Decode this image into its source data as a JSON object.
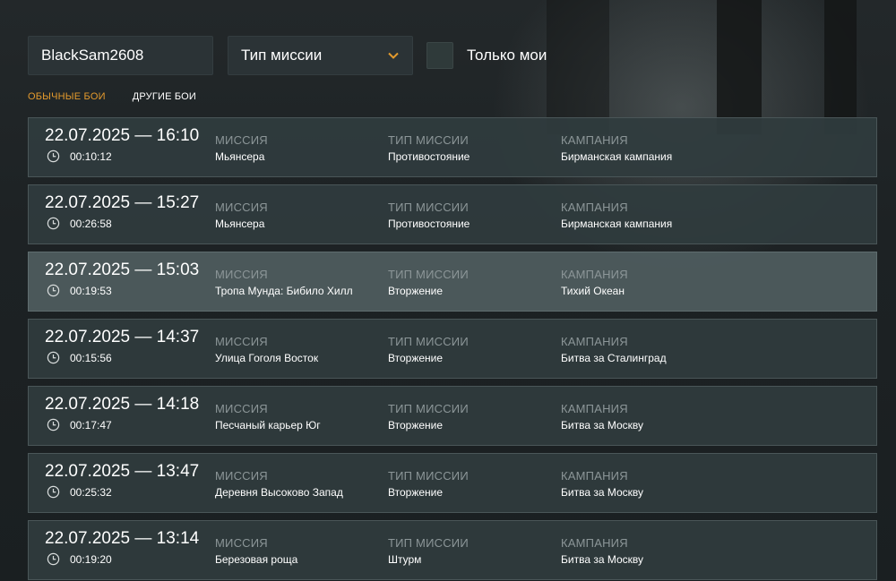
{
  "filters": {
    "username": "BlackSam2608",
    "mission_type_label": "Тип миссии",
    "only_mine_label": "Только мои"
  },
  "tabs": [
    {
      "label": "ОБЫЧНЫЕ БОИ",
      "active": true
    },
    {
      "label": "ДРУГИЕ БОИ",
      "active": false
    }
  ],
  "column_headers": {
    "mission": "МИССИЯ",
    "mission_type": "ТИП МИССИИ",
    "campaign": "КАМПАНИЯ"
  },
  "colors": {
    "accent": "#e39a2d",
    "row_bg": "#303c3e",
    "row_highlight": "#4e5c5e"
  },
  "battles": [
    {
      "datetime": "22.07.2025 — 16:10",
      "duration": "00:10:12",
      "mission": "Мьянсера",
      "mission_type": "Противостояние",
      "campaign": "Бирманская кампания",
      "highlighted": false
    },
    {
      "datetime": "22.07.2025 — 15:27",
      "duration": "00:26:58",
      "mission": "Мьянсера",
      "mission_type": "Противостояние",
      "campaign": "Бирманская кампания",
      "highlighted": false
    },
    {
      "datetime": "22.07.2025 — 15:03",
      "duration": "00:19:53",
      "mission": "Тропа Мунда: Бибило Хилл",
      "mission_type": "Вторжение",
      "campaign": "Тихий Океан",
      "highlighted": true
    },
    {
      "datetime": "22.07.2025 — 14:37",
      "duration": "00:15:56",
      "mission": "Улица Гоголя Восток",
      "mission_type": "Вторжение",
      "campaign": "Битва за Сталинград",
      "highlighted": false
    },
    {
      "datetime": "22.07.2025 — 14:18",
      "duration": "00:17:47",
      "mission": "Песчаный карьер Юг",
      "mission_type": "Вторжение",
      "campaign": "Битва за Москву",
      "highlighted": false
    },
    {
      "datetime": "22.07.2025 — 13:47",
      "duration": "00:25:32",
      "mission": "Деревня Высоково Запад",
      "mission_type": "Вторжение",
      "campaign": "Битва за Москву",
      "highlighted": false
    },
    {
      "datetime": "22.07.2025 — 13:14",
      "duration": "00:19:20",
      "mission": "Березовая роща",
      "mission_type": "Штурм",
      "campaign": "Битва за Москву",
      "highlighted": false
    }
  ]
}
